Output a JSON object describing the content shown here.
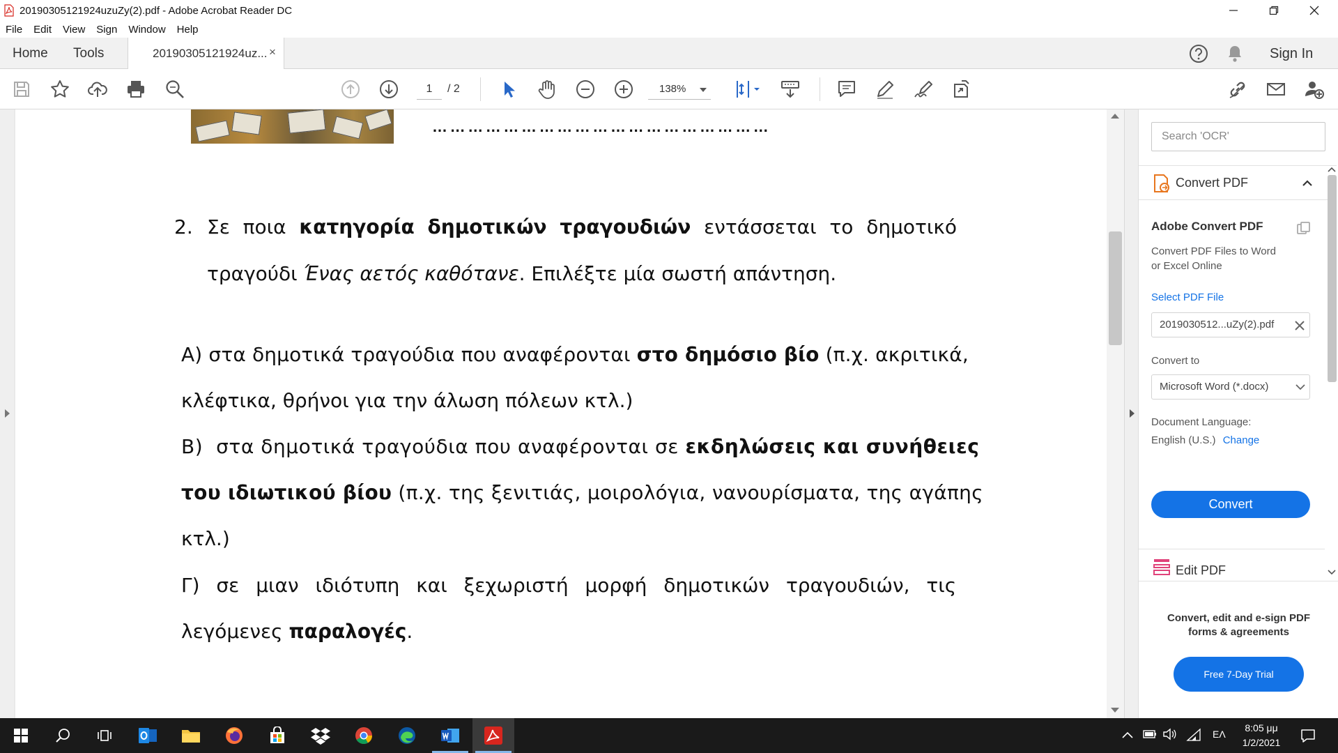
{
  "window": {
    "title": "20190305121924uzuZy(2).pdf - Adobe Acrobat Reader DC"
  },
  "menu": [
    "File",
    "Edit",
    "View",
    "Sign",
    "Window",
    "Help"
  ],
  "tabs": {
    "home": "Home",
    "tools": "Tools",
    "document": "20190305121924uz...",
    "close": "×",
    "sign_in": "Sign In"
  },
  "toolbar": {
    "current_page": "1",
    "total_pages": "/ 2",
    "zoom": "138%"
  },
  "document": {
    "dots": "…………………………………………………",
    "q2": {
      "number": "2.",
      "line1_words": [
        "Σε",
        "ποια"
      ],
      "line1_bold": [
        "κατηγορία",
        "δημοτικών",
        "τραγουδιών"
      ],
      "line1_tail": [
        "εντάσσεται",
        "το",
        "δημοτικό"
      ],
      "line2_pre": "τραγούδι ",
      "line2_italic": "Ένας αετός καθότανε",
      "line2_post": ". Επιλέξτε μία σωστή απάντηση."
    },
    "optA": {
      "pre": "Α) στα δημοτικά τραγούδια που αναφέρονται ",
      "bold": "στο δημόσιο βίο",
      "post": " (π.χ. ακριτικά,",
      "line2": "κλέφτικα, θρήνοι για την άλωση πόλεων κτλ.)"
    },
    "optB": {
      "pre": "Β)  στα δημοτικά τραγούδια που αναφέρονται σε ",
      "bold": "εκδηλώσεις και συνήθειες",
      "line2_bold": "του ιδιωτικού βίου",
      "line2_post": " (π.χ. της ξενιτιάς, μοιρολόγια, νανουρίσματα, της αγάπης",
      "line3": "κτλ.)"
    },
    "optC": {
      "line1": "Γ) σε μιαν ιδιότυπη και ξεχωριστή μορφή δημοτικών τραγουδιών, τις",
      "line2_pre": "λεγόμενες ",
      "line2_bold": "παραλογές",
      "line2_post": "."
    }
  },
  "panel": {
    "search_placeholder": "Search 'OCR'",
    "convert_pdf": "Convert PDF",
    "adobe_convert_title": "Adobe Convert PDF",
    "adobe_convert_desc1": "Convert PDF Files to Word",
    "adobe_convert_desc2": "or Excel Online",
    "select_pdf_file": "Select PDF File",
    "selected_file": "2019030512...uZy(2).pdf",
    "convert_to": "Convert to",
    "convert_format": "Microsoft Word (*.docx)",
    "doc_language_label": "Document Language:",
    "doc_language": "English (U.S.)",
    "change": "Change",
    "convert_button": "Convert",
    "edit_pdf": "Edit PDF",
    "promo_line1": "Convert, edit and e-sign PDF",
    "promo_line2": "forms & agreements",
    "trial_button": "Free 7-Day Trial"
  },
  "taskbar": {
    "language": "ΕΛ",
    "time": "8:05 μμ",
    "date": "1/2/2021"
  },
  "colors": {
    "accent": "#1473e6",
    "acrobat_red": "#d7261e"
  }
}
